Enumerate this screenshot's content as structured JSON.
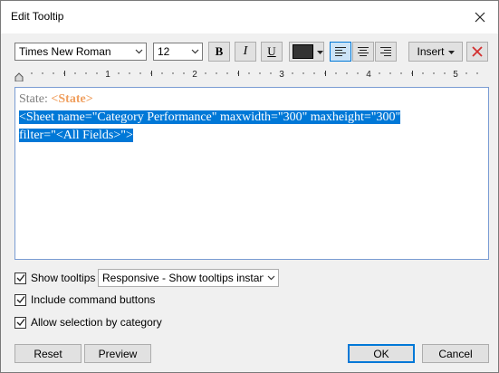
{
  "window": {
    "title": "Edit Tooltip",
    "close_icon": "close-icon"
  },
  "toolbar": {
    "font_family": "Times New Roman",
    "font_size": "12",
    "bold_label": "B",
    "italic_label": "I",
    "underline_label": "U",
    "font_color": "#333333",
    "align_left_icon": "align-left-icon",
    "align_center_icon": "align-center-icon",
    "align_right_icon": "align-right-icon",
    "insert_label": "Insert",
    "clear_icon": "clear-icon"
  },
  "ruler": {
    "labels": [
      "1",
      "2",
      "3",
      "4",
      "5"
    ]
  },
  "editor": {
    "line1_label": "State:",
    "line1_field": "<State>",
    "line2": "<Sheet name=\"Category Performance\" maxwidth=\"300\" maxheight=\"300\"",
    "line3": "filter=\"<All Fields>\">"
  },
  "options": {
    "show_tooltips_label": "Show tooltips",
    "show_tooltips_checked": true,
    "tooltip_mode": "Responsive - Show tooltips instantly",
    "include_command_buttons_label": "Include command buttons",
    "include_command_buttons_checked": true,
    "allow_selection_label": "Allow selection by category",
    "allow_selection_checked": true
  },
  "buttons": {
    "reset": "Reset",
    "preview": "Preview",
    "ok": "OK",
    "cancel": "Cancel"
  },
  "colors": {
    "accent": "#0078d7",
    "field": "#f0a060",
    "selection": "#0078d7"
  }
}
